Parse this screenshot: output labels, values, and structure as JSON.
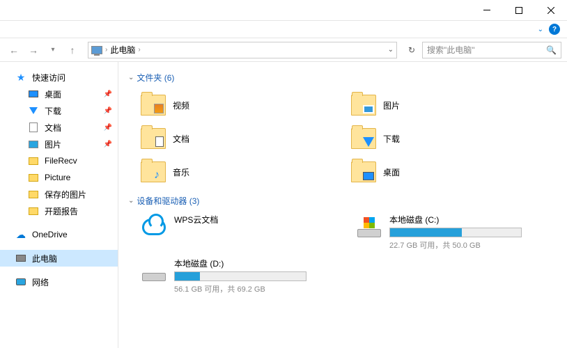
{
  "breadcrumb": {
    "location": "此电脑"
  },
  "search": {
    "placeholder": "搜索\"此电脑\""
  },
  "sidebar": {
    "quick_access": "快速访问",
    "items": [
      {
        "label": "桌面",
        "pinned": true
      },
      {
        "label": "下载",
        "pinned": true
      },
      {
        "label": "文档",
        "pinned": true
      },
      {
        "label": "图片",
        "pinned": true
      },
      {
        "label": "FileRecv",
        "pinned": false
      },
      {
        "label": "Picture",
        "pinned": false
      },
      {
        "label": "保存的图片",
        "pinned": false
      },
      {
        "label": "开题报告",
        "pinned": false
      }
    ],
    "onedrive": "OneDrive",
    "this_pc": "此电脑",
    "network": "网络"
  },
  "sections": {
    "folders": {
      "title": "文件夹 (6)"
    },
    "devices": {
      "title": "设备和驱动器 (3)"
    }
  },
  "folders": [
    {
      "label": "视频"
    },
    {
      "label": "图片"
    },
    {
      "label": "文档"
    },
    {
      "label": "下载"
    },
    {
      "label": "音乐"
    },
    {
      "label": "桌面"
    }
  ],
  "devices": {
    "wps": {
      "label": "WPS云文档"
    },
    "c": {
      "label": "本地磁盘 (C:)",
      "free": "22.7 GB",
      "total": "50.0 GB",
      "stat": "22.7 GB 可用，共 50.0 GB",
      "used_pct": 54.6
    },
    "d": {
      "label": "本地磁盘 (D:)",
      "free": "56.1 GB",
      "total": "69.2 GB",
      "stat": "56.1 GB 可用，共 69.2 GB",
      "used_pct": 18.9
    }
  }
}
